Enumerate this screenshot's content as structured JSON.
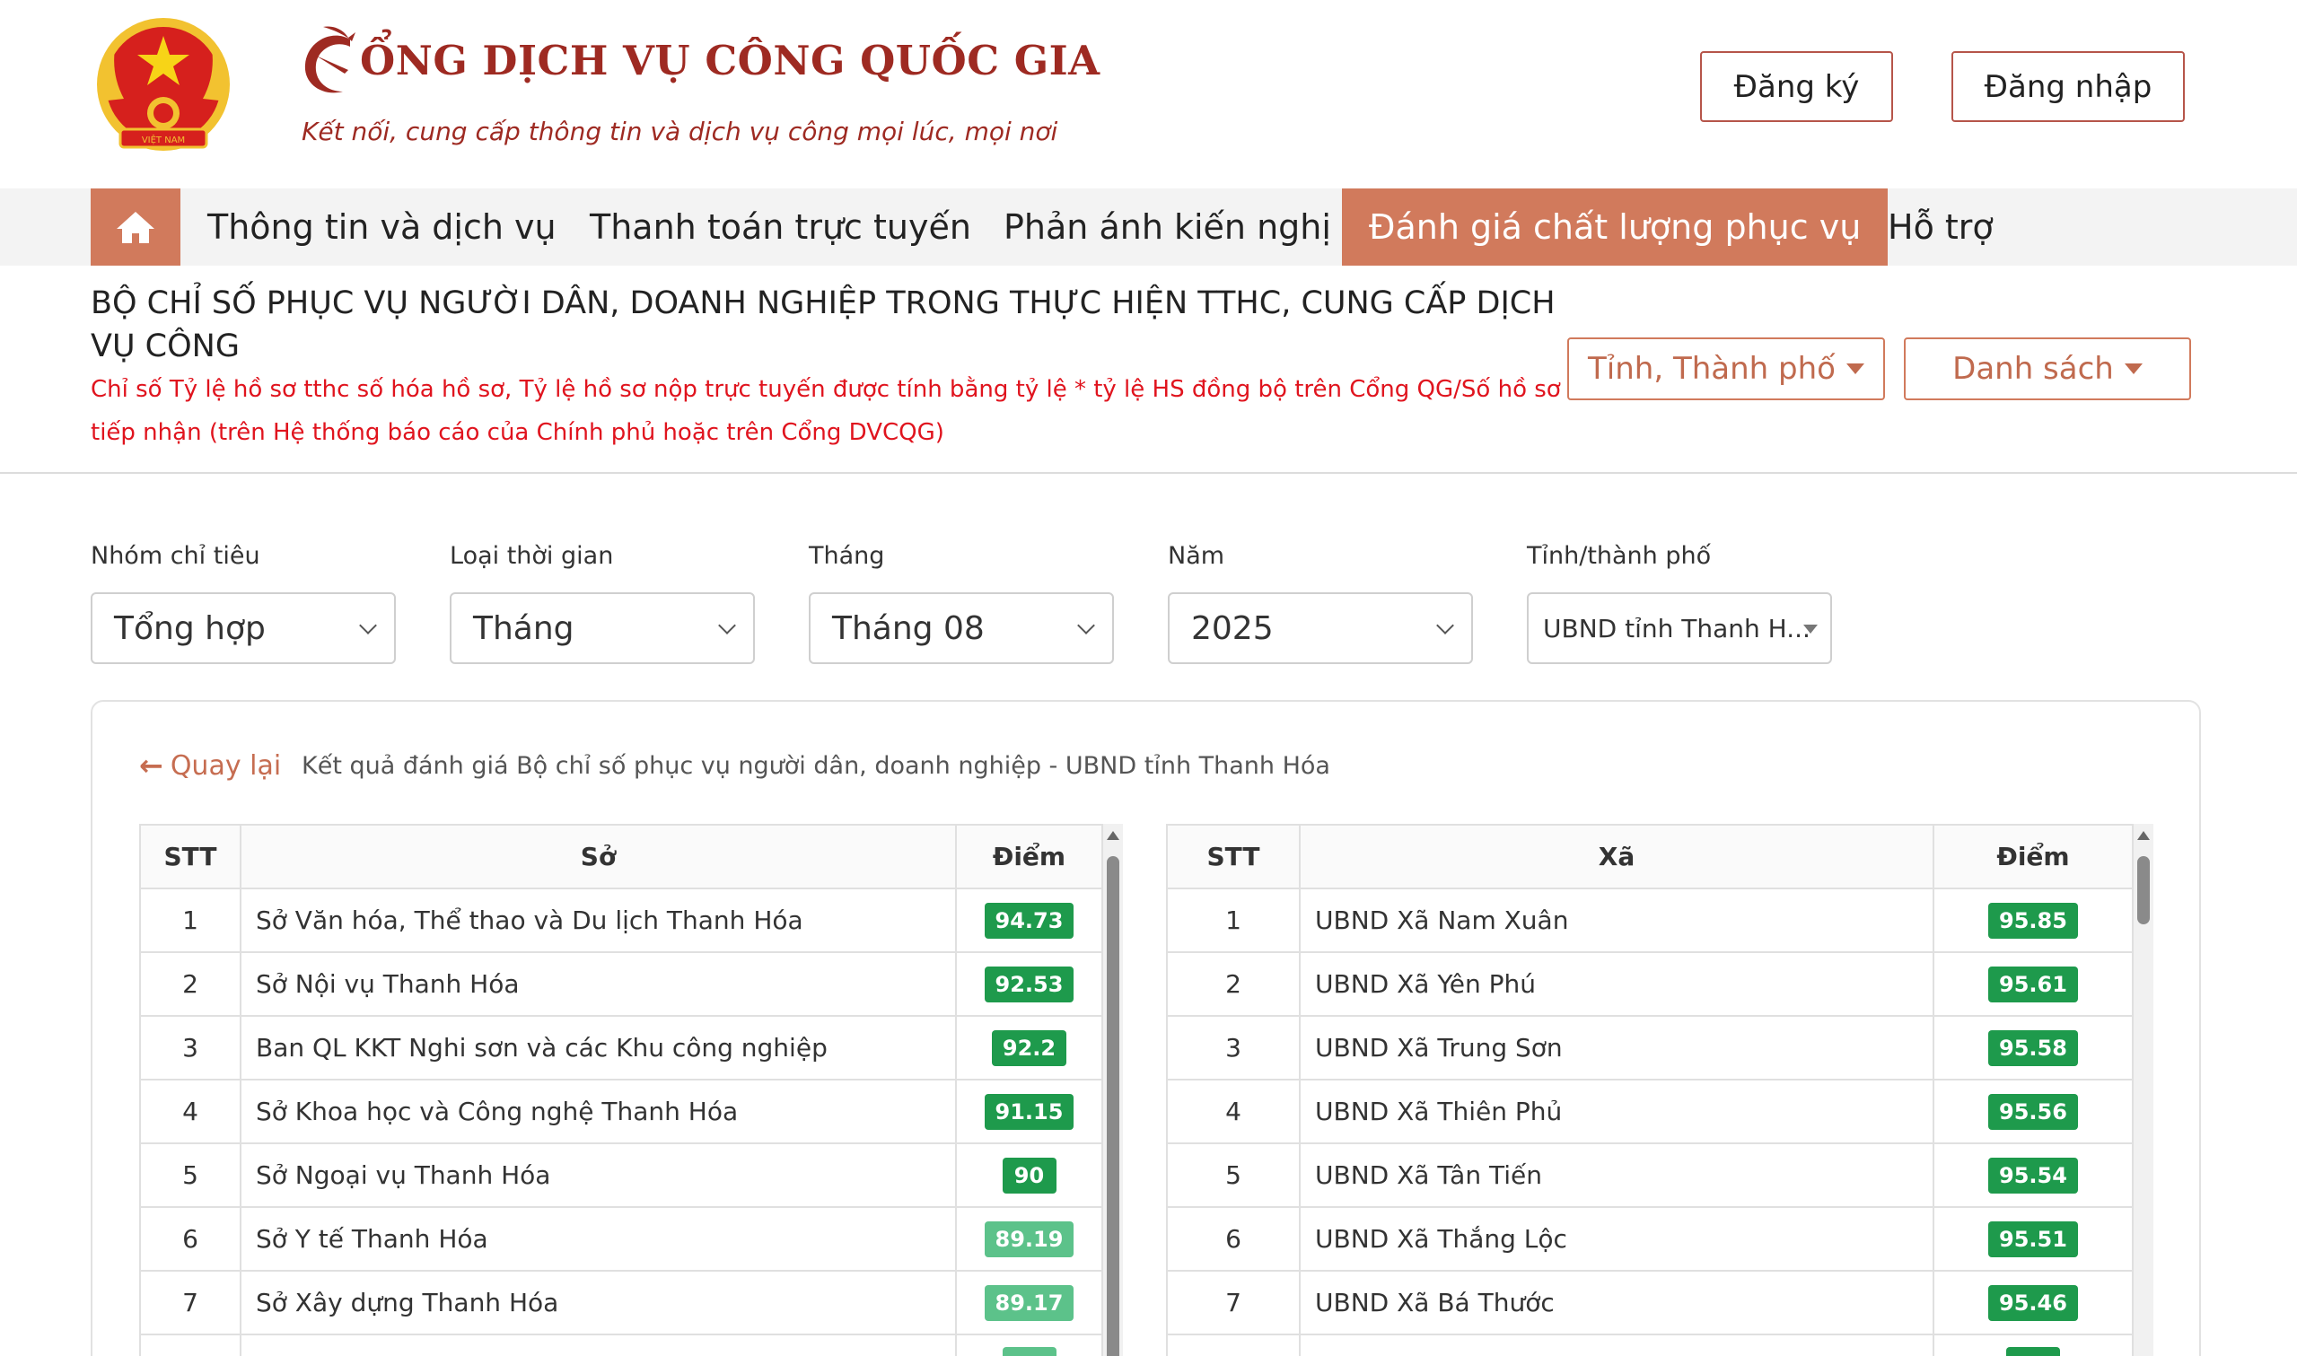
{
  "header": {
    "brand_title": "ỔNG DỊCH VỤ CÔNG QUỐC GIA",
    "brand_subtitle": "Kết nối, cung cấp thông tin và dịch vụ công mọi lúc, mọi nơi",
    "register_label": "Đăng ký",
    "login_label": "Đăng nhập",
    "emblem_text": "VIỆT NAM"
  },
  "nav": {
    "home_icon": "home-icon",
    "items": [
      "Thông tin và dịch vụ",
      "Thanh toán trực tuyến",
      "Phản ánh kiến nghị",
      "Đánh giá chất lượng phục vụ",
      "Hỗ trợ"
    ],
    "active_index": 3
  },
  "band": {
    "title": "BỘ CHỈ SỐ PHỤC VỤ NGƯỜI DÂN, DOANH NGHIỆP TRONG THỰC HIỆN TTHC, CUNG CẤP DỊCH VỤ CÔNG",
    "note": "Chỉ số Tỷ lệ hồ sơ tthc số hóa hồ sơ, Tỷ lệ hồ sơ nộp trực tuyến được tính bằng tỷ lệ * tỷ lệ HS đồng bộ trên Cổng QG/Số hồ sơ tiếp nhận (trên Hệ thống báo cáo của Chính phủ hoặc trên Cổng DVCQG)",
    "province_select": "Tỉnh, Thành phố",
    "list_select": "Danh sách"
  },
  "filters": [
    {
      "label": "Nhóm chỉ tiêu",
      "value": "Tổng hợp"
    },
    {
      "label": "Loại thời gian",
      "value": "Tháng"
    },
    {
      "label": "Tháng",
      "value": "Tháng 08"
    },
    {
      "label": "Năm",
      "value": "2025"
    },
    {
      "label": "Tỉnh/thành phố",
      "value": "UBND tỉnh Thanh H..."
    }
  ],
  "result": {
    "back_label": "Quay lại",
    "heading": "Kết quả đánh giá Bộ chỉ số phục vụ người dân, doanh nghiệp - UBND tỉnh Thanh Hóa"
  },
  "left_table": {
    "headers": [
      "STT",
      "Sở",
      "Điểm"
    ],
    "rows": [
      {
        "stt": "1",
        "name": "Sở Văn hóa, Thể thao và Du lịch Thanh Hóa",
        "score": "94.73",
        "color": "#1e9a4c"
      },
      {
        "stt": "2",
        "name": "Sở Nội vụ Thanh Hóa",
        "score": "92.53",
        "color": "#1e9a4c"
      },
      {
        "stt": "3",
        "name": "Ban QL KKT Nghi sơn và các Khu công nghiệp",
        "score": "92.2",
        "color": "#1e9a4c"
      },
      {
        "stt": "4",
        "name": "Sở Khoa học và Công nghệ Thanh Hóa",
        "score": "91.15",
        "color": "#1e9a4c"
      },
      {
        "stt": "5",
        "name": "Sở Ngoại vụ Thanh Hóa",
        "score": "90",
        "color": "#1e9a4c"
      },
      {
        "stt": "6",
        "name": "Sở Y tế Thanh Hóa",
        "score": "89.19",
        "color": "#5cc28a"
      },
      {
        "stt": "7",
        "name": "Sở Xây dựng Thanh Hóa",
        "score": "89.17",
        "color": "#5cc28a"
      },
      {
        "stt": "",
        "name": "",
        "score": "",
        "color": "#5cc28a"
      }
    ]
  },
  "right_table": {
    "headers": [
      "STT",
      "Xã",
      "Điểm"
    ],
    "rows": [
      {
        "stt": "1",
        "name": "UBND Xã Nam Xuân",
        "score": "95.85",
        "color": "#1e9a4c"
      },
      {
        "stt": "2",
        "name": "UBND Xã Yên Phú",
        "score": "95.61",
        "color": "#1e9a4c"
      },
      {
        "stt": "3",
        "name": "UBND Xã Trung Sơn",
        "score": "95.58",
        "color": "#1e9a4c"
      },
      {
        "stt": "4",
        "name": "UBND Xã Thiên Phủ",
        "score": "95.56",
        "color": "#1e9a4c"
      },
      {
        "stt": "5",
        "name": "UBND Xã Tân Tiến",
        "score": "95.54",
        "color": "#1e9a4c"
      },
      {
        "stt": "6",
        "name": "UBND Xã Thắng Lộc",
        "score": "95.51",
        "color": "#1e9a4c"
      },
      {
        "stt": "7",
        "name": "UBND Xã Bá Thước",
        "score": "95.46",
        "color": "#1e9a4c"
      },
      {
        "stt": "",
        "name": "",
        "score": "",
        "color": "#1e9a4c"
      }
    ]
  },
  "colors": {
    "brand_red": "#9e2a22",
    "accent": "#d17a5c",
    "badge_green": "#1e9a4c",
    "badge_light_green": "#5cc28a",
    "note_red": "#e0141e"
  }
}
